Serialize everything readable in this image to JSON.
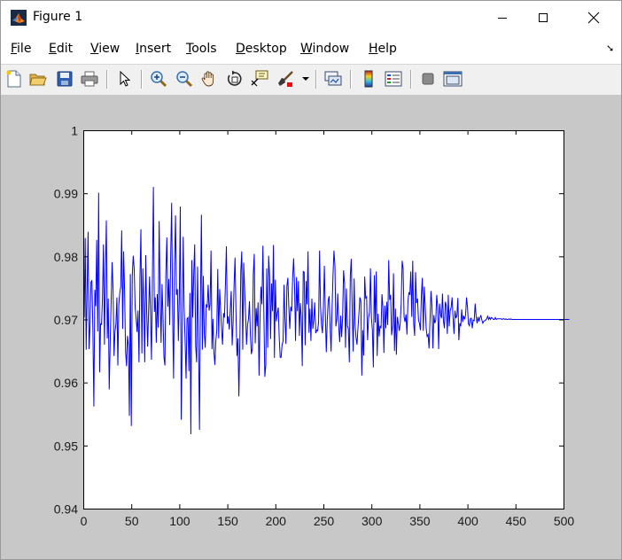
{
  "window": {
    "title": "Figure 1",
    "app_icon": "matlab-logo-icon"
  },
  "menu": [
    {
      "underline": "F",
      "rest": "ile"
    },
    {
      "underline": "E",
      "rest": "dit"
    },
    {
      "underline": "V",
      "rest": "iew"
    },
    {
      "underline": "I",
      "rest": "nsert"
    },
    {
      "underline": "T",
      "rest": "ools"
    },
    {
      "underline": "D",
      "rest": "esktop"
    },
    {
      "underline": "W",
      "rest": "indow"
    },
    {
      "underline": "H",
      "rest": "elp"
    }
  ],
  "dock_arrow": "➘",
  "toolbar_icons": [
    "new-figure-icon",
    "open-file-icon",
    "save-icon",
    "print-icon",
    "edit-plot-arrow-icon",
    "zoom-in-icon",
    "zoom-out-icon",
    "pan-hand-icon",
    "rotate-3d-icon",
    "data-cursor-icon",
    "brush-icon",
    "brush-dropdown-icon",
    "link-plot-icon",
    "colorbar-icon",
    "legend-icon",
    "hide-plot-tools-icon",
    "show-plot-tools-icon"
  ],
  "chart_data": {
    "type": "line",
    "series_color": "#0000ff",
    "xlim": [
      0,
      500
    ],
    "ylim": [
      0.94,
      1.0
    ],
    "xticks": [
      "0",
      "50",
      "100",
      "150",
      "200",
      "250",
      "300",
      "350",
      "400",
      "450",
      "500"
    ],
    "yticks": [
      "0.94",
      "0.95",
      "0.96",
      "0.97",
      "0.98",
      "0.99",
      "1"
    ],
    "grid": false,
    "series": [
      {
        "x_start": 1,
        "x_step": 1,
        "values": [
          0.9703,
          0.9829,
          0.9652,
          0.9748,
          0.9839,
          0.9653,
          0.9688,
          0.9759,
          0.9762,
          0.9681,
          0.9562,
          0.9747,
          0.9721,
          0.9826,
          0.9681,
          0.9901,
          0.9616,
          0.9693,
          0.9692,
          0.9734,
          0.9819,
          0.966,
          0.9776,
          0.9857,
          0.967,
          0.9733,
          0.9589,
          0.9662,
          0.9728,
          0.9791,
          0.9748,
          0.9642,
          0.9681,
          0.9693,
          0.9735,
          0.9627,
          0.9724,
          0.9742,
          0.9752,
          0.9841,
          0.9685,
          0.9808,
          0.9747,
          0.965,
          0.9626,
          0.9674,
          0.9658,
          0.9547,
          0.9772,
          0.9531,
          0.977,
          0.9801,
          0.978,
          0.9719,
          0.9702,
          0.968,
          0.9714,
          0.9632,
          0.9766,
          0.9843,
          0.9646,
          0.9781,
          0.9724,
          0.9632,
          0.9802,
          0.9714,
          0.9657,
          0.9714,
          0.9768,
          0.9707,
          0.9636,
          0.9768,
          0.991,
          0.9712,
          0.9735,
          0.9663,
          0.974,
          0.9687,
          0.9856,
          0.9737,
          0.9663,
          0.9756,
          0.9704,
          0.964,
          0.9627,
          0.9774,
          0.983,
          0.972,
          0.9764,
          0.9691,
          0.9801,
          0.9885,
          0.971,
          0.9606,
          0.9786,
          0.9865,
          0.9739,
          0.9748,
          0.9666,
          0.9738,
          0.9879,
          0.9541,
          0.9669,
          0.9831,
          0.9719,
          0.9667,
          0.9606,
          0.9701,
          0.9703,
          0.9618,
          0.9742,
          0.9518,
          0.9794,
          0.9703,
          0.9773,
          0.9819,
          0.9658,
          0.9632,
          0.9784,
          0.9663,
          0.9525,
          0.9731,
          0.9866,
          0.9652,
          0.9769,
          0.9678,
          0.9655,
          0.9724,
          0.9719,
          0.9755,
          0.9714,
          0.9725,
          0.9809,
          0.9653,
          0.9701,
          0.9648,
          0.9628,
          0.9666,
          0.9683,
          0.978,
          0.967,
          0.9748,
          0.9715,
          0.9683,
          0.966,
          0.971,
          0.9703,
          0.9756,
          0.9816,
          0.9693,
          0.9705,
          0.9684,
          0.9715,
          0.9745,
          0.9659,
          0.9695,
          0.9755,
          0.9798,
          0.9709,
          0.9642,
          0.967,
          0.9578,
          0.9665,
          0.9776,
          0.9808,
          0.9652,
          0.979,
          0.9747,
          0.9707,
          0.966,
          0.9691,
          0.9701,
          0.9729,
          0.9675,
          0.9645,
          0.9653,
          0.9772,
          0.9804,
          0.9662,
          0.9718,
          0.9689,
          0.9727,
          0.9611,
          0.9703,
          0.9752,
          0.9724,
          0.9817,
          0.9713,
          0.9609,
          0.9627,
          0.9781,
          0.9655,
          0.9801,
          0.9767,
          0.9669,
          0.9757,
          0.9713,
          0.9818,
          0.9639,
          0.9763,
          0.9697,
          0.971,
          0.9719,
          0.9671,
          0.964,
          0.964,
          0.966,
          0.9665,
          0.9755,
          0.97,
          0.9661,
          0.9753,
          0.9766,
          0.9719,
          0.9685,
          0.972,
          0.9713,
          0.9767,
          0.9797,
          0.9752,
          0.9666,
          0.9767,
          0.9713,
          0.9761,
          0.9674,
          0.9726,
          0.9703,
          0.9626,
          0.9776,
          0.9775,
          0.9659,
          0.9761,
          0.9724,
          0.9808,
          0.9679,
          0.9717,
          0.9666,
          0.9733,
          0.9685,
          0.97,
          0.9727,
          0.9678,
          0.9683,
          0.9682,
          0.9696,
          0.9809,
          0.9721,
          0.9692,
          0.9678,
          0.9718,
          0.9785,
          0.971,
          0.9648,
          0.9698,
          0.973,
          0.9737,
          0.9687,
          0.9649,
          0.9715,
          0.977,
          0.9809,
          0.9785,
          0.9689,
          0.97,
          0.9741,
          0.9688,
          0.9664,
          0.9706,
          0.9672,
          0.9704,
          0.9778,
          0.9757,
          0.9655,
          0.9749,
          0.969,
          0.9685,
          0.9632,
          0.9769,
          0.9796,
          0.9717,
          0.9649,
          0.9765,
          0.9691,
          0.9671,
          0.966,
          0.9687,
          0.9709,
          0.9735,
          0.9729,
          0.9611,
          0.9683,
          0.9643,
          0.9768,
          0.9734,
          0.9736,
          0.9667,
          0.9702,
          0.9712,
          0.9781,
          0.9703,
          0.9683,
          0.9624,
          0.977,
          0.9695,
          0.9776,
          0.9642,
          0.9709,
          0.9673,
          0.969,
          0.9686,
          0.974,
          0.9718,
          0.9647,
          0.9722,
          0.9686,
          0.9728,
          0.9691,
          0.9794,
          0.9731,
          0.9739,
          0.9675,
          0.969,
          0.9773,
          0.965,
          0.9717,
          0.9644,
          0.9704,
          0.9694,
          0.9682,
          0.9694,
          0.9726,
          0.9793,
          0.9781,
          0.9704,
          0.9696,
          0.9708,
          0.9676,
          0.9728,
          0.9743,
          0.9739,
          0.9776,
          0.9704,
          0.9793,
          0.9693,
          0.9674,
          0.9775,
          0.9726,
          0.9733,
          0.9699,
          0.9694,
          0.9683,
          0.9738,
          0.9766,
          0.9682,
          0.9752,
          0.9721,
          0.9686,
          0.9673,
          0.9676,
          0.9654,
          0.9698,
          0.9745,
          0.9722,
          0.9654,
          0.9707,
          0.9694,
          0.9699,
          0.9739,
          0.972,
          0.9653,
          0.9725,
          0.9707,
          0.9702,
          0.9741,
          0.9697,
          0.9686,
          0.9728,
          0.9722,
          0.9677,
          0.9739,
          0.9689,
          0.9714,
          0.9719,
          0.9735,
          0.9702,
          0.9677,
          0.9714,
          0.9702,
          0.9706,
          0.9734,
          0.9667,
          0.9694,
          0.9689,
          0.9716,
          0.9696,
          0.9706,
          0.97,
          0.9706,
          0.9735,
          0.972,
          0.9693,
          0.969,
          0.9701,
          0.9702,
          0.9686,
          0.9699,
          0.9698,
          0.9725,
          0.9705,
          0.9694,
          0.9704,
          0.9697,
          0.9703,
          0.9706,
          0.9699,
          0.9694,
          0.9697,
          0.9698,
          0.9699,
          0.9701,
          0.9705,
          0.97,
          0.9703,
          0.97,
          0.9703,
          0.9702,
          0.97,
          0.97,
          0.9703,
          0.97,
          0.9701,
          0.9701,
          0.9701,
          0.9701,
          0.9701,
          0.97,
          0.9701,
          0.9701,
          0.97,
          0.9701,
          0.97,
          0.97,
          0.9701,
          0.97,
          0.9701,
          0.97,
          0.97,
          0.97,
          0.97,
          0.97,
          0.97,
          0.97,
          0.97,
          0.97,
          0.97,
          0.97,
          0.97,
          0.97,
          0.97,
          0.97,
          0.97,
          0.97,
          0.97,
          0.97,
          0.97,
          0.97,
          0.97,
          0.97,
          0.97,
          0.97,
          0.97,
          0.97,
          0.97,
          0.97,
          0.97,
          0.97,
          0.97,
          0.97,
          0.97,
          0.97,
          0.97,
          0.97,
          0.97,
          0.97,
          0.97,
          0.97,
          0.97,
          0.97,
          0.97,
          0.97,
          0.97,
          0.97,
          0.97,
          0.97,
          0.97,
          0.97,
          0.97,
          0.97,
          0.97,
          0.97,
          0.97,
          0.97,
          0.97,
          0.97,
          0.97,
          0.97
        ]
      }
    ]
  }
}
